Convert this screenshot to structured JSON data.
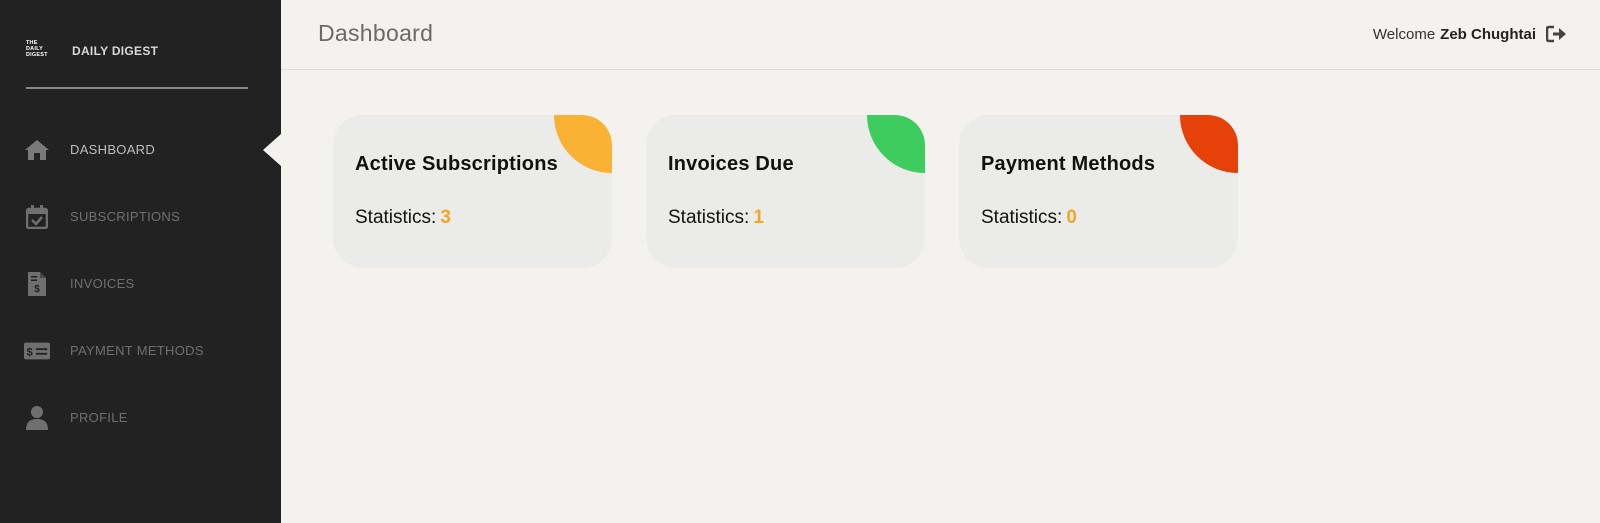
{
  "brand": {
    "logo_text": [
      "THE",
      "DAILY",
      "DIGEST"
    ],
    "name": "DAILY DIGEST"
  },
  "sidebar": {
    "items": [
      {
        "label": "DASHBOARD",
        "icon": "home-icon",
        "active": true
      },
      {
        "label": "SUBSCRIPTIONS",
        "icon": "calendar-check-icon",
        "active": false
      },
      {
        "label": "INVOICES",
        "icon": "invoice-dollar-icon",
        "active": false
      },
      {
        "label": "PAYMENT METHODS",
        "icon": "money-check-icon",
        "active": false
      },
      {
        "label": "PROFILE",
        "icon": "user-icon",
        "active": false
      }
    ]
  },
  "header": {
    "title": "Dashboard",
    "welcome_text": "Welcome",
    "user_name": "Zeb Chughtai",
    "logout_icon": "sign-out-icon"
  },
  "cards": [
    {
      "title": "Active Subscriptions",
      "stat_label": "Statistics:",
      "stat_value": "3",
      "accent": "#f9b233"
    },
    {
      "title": "Invoices Due",
      "stat_label": "Statistics:",
      "stat_value": "1",
      "accent": "#3ecc5f"
    },
    {
      "title": "Payment Methods",
      "stat_label": "Statistics:",
      "stat_value": "0",
      "accent": "#e64108"
    }
  ],
  "colors": {
    "sidebar_bg": "#222222",
    "page_bg": "#f3f2ef",
    "card_bg": "#ebebe9",
    "stat_value": "#f5a623",
    "nav_icon": "#6f6f6f"
  }
}
